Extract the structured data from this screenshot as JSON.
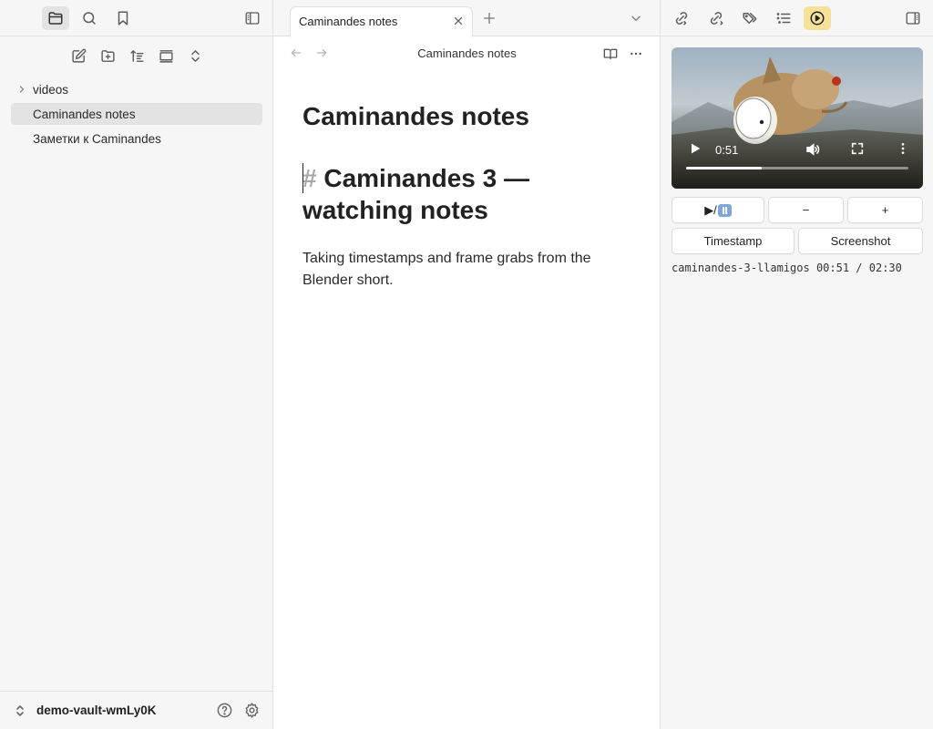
{
  "left_sidebar": {
    "tree": [
      {
        "label": "videos",
        "type": "folder"
      },
      {
        "label": "Caminandes notes",
        "type": "file",
        "selected": true
      },
      {
        "label": "Заметки к Caminandes",
        "type": "file"
      }
    ],
    "vault_name": "demo-vault-wmLy0K"
  },
  "editor": {
    "tab_title": "Caminandes notes",
    "view_title": "Caminandes notes",
    "inline_title": "Caminandes notes",
    "heading_marker": "# ",
    "heading_text": "Caminandes 3 — watching notes",
    "paragraph": "Taking timestamps and frame grabs from the Blender short."
  },
  "right_sidebar": {
    "video": {
      "current_time": "0:51",
      "progress": 0.34
    },
    "buttons": {
      "play_pause_label": "▶/",
      "minus_label": "−",
      "plus_label": "+",
      "timestamp_label": "Timestamp",
      "screenshot_label": "Screenshot"
    },
    "status": "caminandes-3-llamigos 00:51 / 02:30"
  },
  "colors": {
    "sidebar_bg": "#f6f6f6",
    "active_highlight": "#f5e29a",
    "selected_item": "#e3e3e3"
  }
}
